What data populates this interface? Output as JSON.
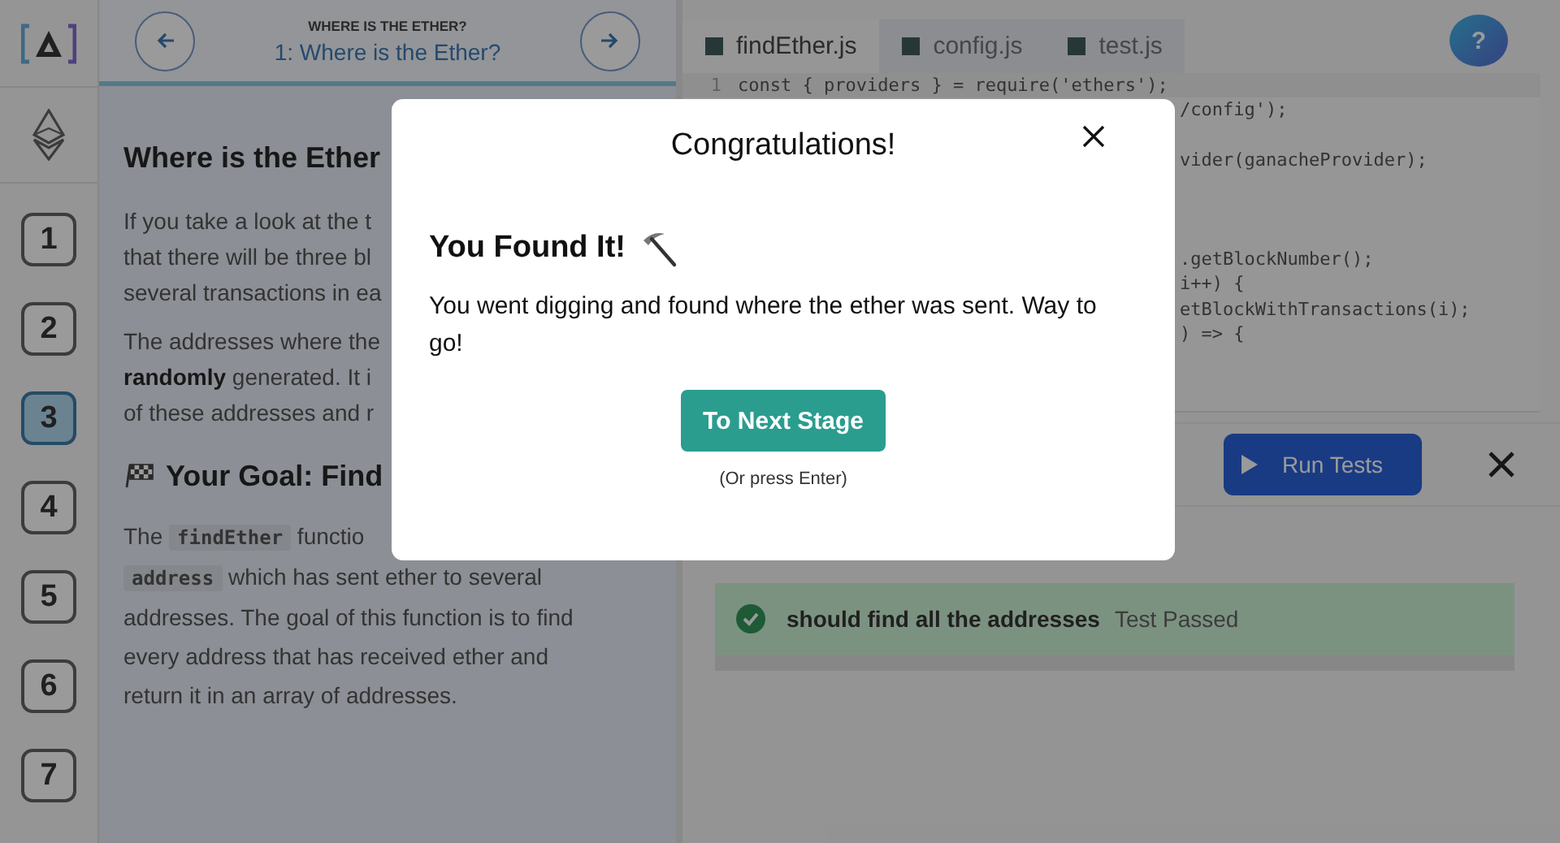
{
  "sidebar": {
    "stages": [
      {
        "label": "1",
        "selected": false
      },
      {
        "label": "2",
        "selected": false
      },
      {
        "label": "3",
        "selected": true
      },
      {
        "label": "4",
        "selected": false
      },
      {
        "label": "5",
        "selected": false
      },
      {
        "label": "6",
        "selected": false
      },
      {
        "label": "7",
        "selected": false
      }
    ]
  },
  "header": {
    "kicker": "WHERE IS THE ETHER?",
    "title": "1: Where is the Ether?"
  },
  "lesson": {
    "blocks": [
      {
        "kind": "heading",
        "lines": [
          [
            {
              "kind": "text",
              "text": "Where is the Ether"
            }
          ]
        ]
      },
      {
        "kind": "paragraph",
        "lines": [
          [
            {
              "kind": "text",
              "text": "If you take a look at the t"
            }
          ],
          [
            {
              "kind": "text",
              "text": "that there will be three bl"
            }
          ],
          [
            {
              "kind": "text",
              "text": "several transactions in ea"
            }
          ]
        ]
      },
      {
        "kind": "paragraph",
        "lines": [
          [
            {
              "kind": "text",
              "text": "The addresses where the"
            }
          ],
          [
            {
              "kind": "bold",
              "text": "randomly"
            },
            {
              "kind": "text",
              "text": " generated. It i"
            }
          ],
          [
            {
              "kind": "text",
              "text": "of these addresses and r"
            }
          ]
        ]
      },
      {
        "kind": "goal",
        "lines": [
          [
            {
              "kind": "text",
              "text": "Your Goal: Find"
            }
          ]
        ]
      },
      {
        "kind": "paragraph",
        "lines": [
          [
            {
              "kind": "text",
              "text": "The "
            },
            {
              "kind": "code",
              "text": "findEther"
            },
            {
              "kind": "text",
              "text": " functio"
            }
          ],
          [
            {
              "kind": "code",
              "text": "address"
            },
            {
              "kind": "text",
              "text": " which has sent ether to several"
            }
          ],
          [
            {
              "kind": "text",
              "text": "addresses. The goal of this function is to find"
            }
          ],
          [
            {
              "kind": "text",
              "text": "every address that has received ether and"
            }
          ],
          [
            {
              "kind": "text",
              "text": "return it in an array of addresses."
            }
          ]
        ]
      }
    ]
  },
  "editor": {
    "tabs": [
      {
        "label": "findEther.js",
        "selected": true
      },
      {
        "label": "config.js",
        "selected": false
      },
      {
        "label": "test.js",
        "selected": false
      }
    ],
    "lines": [
      {
        "kind": "full",
        "number": "1",
        "text": "const { providers } = require('ethers');"
      },
      {
        "kind": "clipped",
        "text": "/config');"
      },
      {
        "kind": "blank"
      },
      {
        "kind": "clipped",
        "text": "vider(ganacheProvider);"
      },
      {
        "kind": "blank"
      },
      {
        "kind": "blank"
      },
      {
        "kind": "blank"
      },
      {
        "kind": "clipped",
        "text": ".getBlockNumber();"
      },
      {
        "kind": "clipped",
        "text": "i++) {"
      },
      {
        "kind": "clipped",
        "text": "etBlockWithTransactions(i);"
      },
      {
        "kind": "clipped",
        "text": ") => {"
      }
    ]
  },
  "help_button": {
    "label": "?"
  },
  "tests": {
    "run_button": "Run Tests",
    "results": [
      {
        "name": "should find all the addresses",
        "status": "Test Passed",
        "passed": true
      }
    ]
  },
  "modal": {
    "title": "Congratulations!",
    "heading": "You Found It!",
    "message": "You went digging and found where the ether was sent. Way to go!",
    "button": "To Next Stage",
    "hint": "(Or press Enter)"
  }
}
